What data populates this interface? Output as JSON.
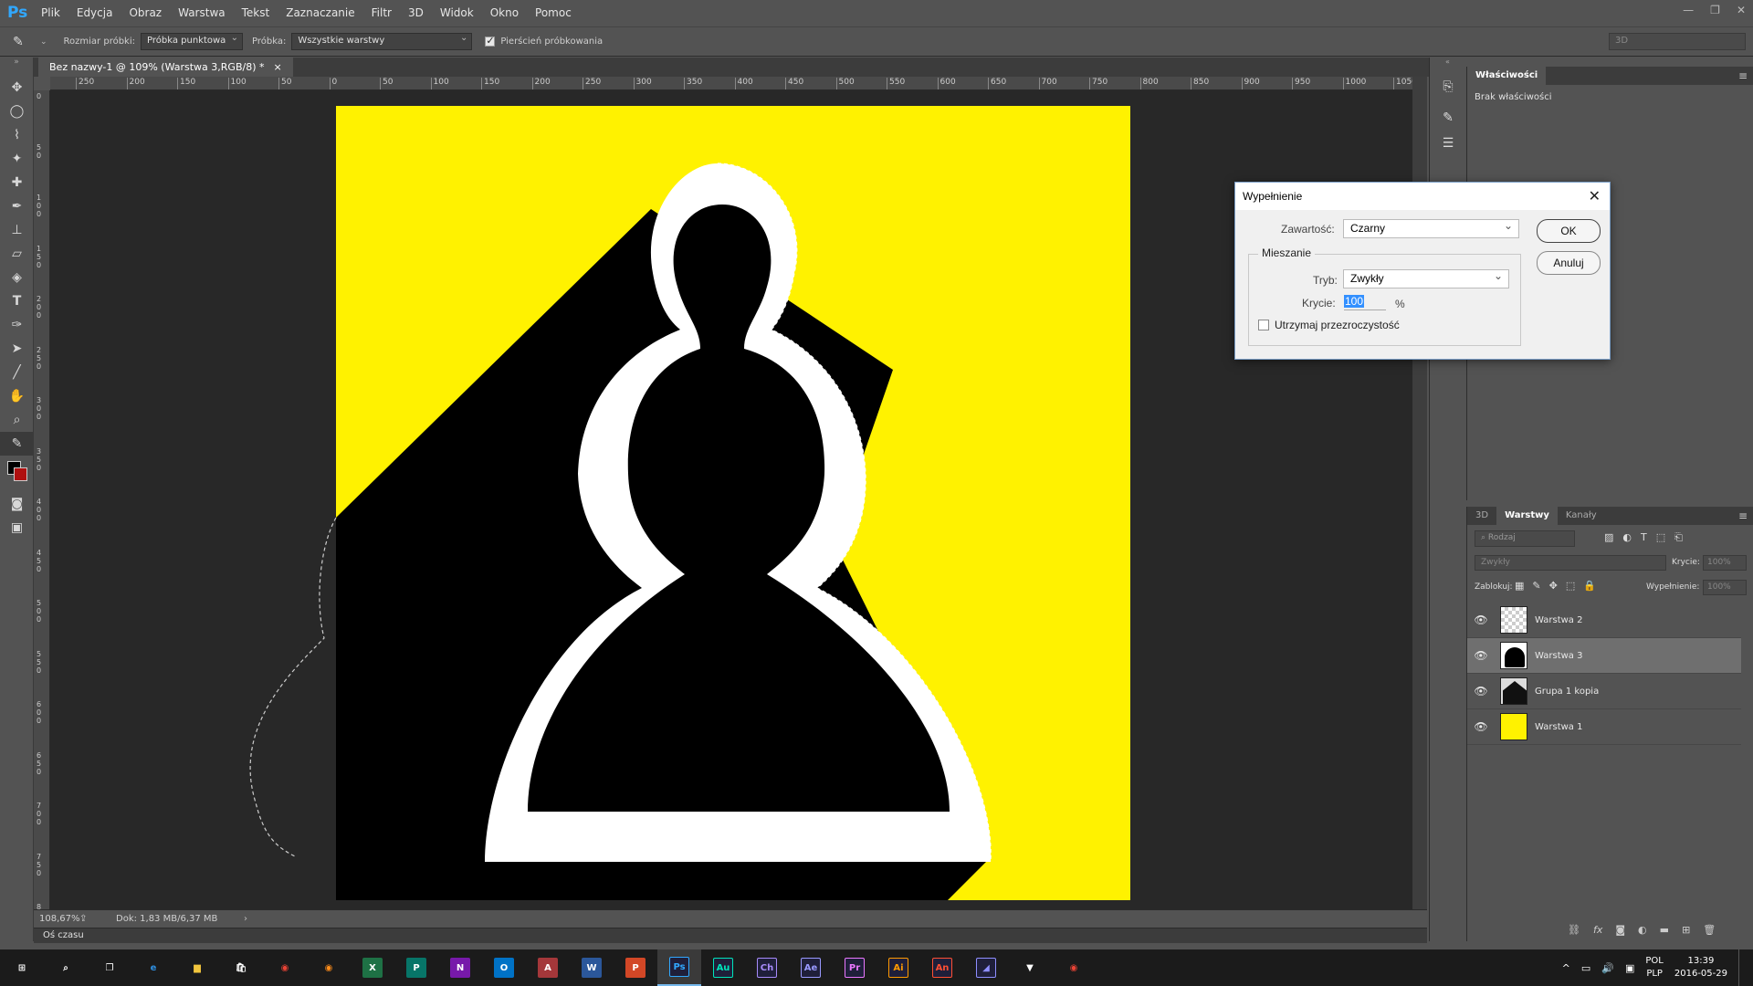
{
  "app": {
    "logo": "Ps",
    "menu": [
      "Plik",
      "Edycja",
      "Obraz",
      "Warstwa",
      "Tekst",
      "Zaznaczanie",
      "Filtr",
      "3D",
      "Widok",
      "Okno",
      "Pomoc"
    ],
    "window_controls": [
      "—",
      "❐",
      "✕"
    ]
  },
  "options_bar": {
    "sample_size_label": "Rozmiar próbki:",
    "sample_size_value": "Próbka punktowa",
    "sample_label": "Próbka:",
    "sample_value": "Wszystkie warstwy",
    "sampling_ring_label": "Pierścień próbkowania",
    "sampling_ring_checked": true,
    "workspace_value": "3D"
  },
  "document": {
    "tab_title": "Bez nazwy-1 @ 109% (Warstwa 3,RGB/8) *",
    "tab_close": "×",
    "zoom": "108,67%",
    "doc_size": "Dok: 1,83 MB/6,37 MB",
    "ruler_top": [
      "250",
      "200",
      "150",
      "100",
      "50",
      "0",
      "50",
      "100",
      "150",
      "200",
      "250",
      "300",
      "350",
      "400",
      "450",
      "500",
      "550",
      "600",
      "650",
      "700",
      "750",
      "800",
      "850",
      "900",
      "950",
      "1000",
      "1050"
    ],
    "ruler_left": [
      "0",
      "5 0",
      "1 0 0",
      "1 5 0",
      "2 0 0",
      "2 5 0",
      "3 0 0",
      "3 5 0",
      "4 0 0",
      "4 5 0",
      "5 0 0",
      "5 5 0",
      "6 0 0",
      "6 5 0",
      "7 0 0",
      "7 5 0",
      "8"
    ],
    "canvas_colors": {
      "yellow": "#fff200",
      "black": "#000000",
      "white": "#ffffff"
    }
  },
  "timeline_label": "Oś czasu",
  "properties_panel": {
    "tab": "Właściwości",
    "empty_text": "Brak właściwości"
  },
  "layers_panel": {
    "tabs": [
      "3D",
      "Warstwy",
      "Kanały"
    ],
    "active_tab": "Warstwy",
    "filter_placeholder": "Rodzaj",
    "blend_mode": "Zwykły",
    "opacity_label": "Krycie:",
    "opacity_value": "100%",
    "lock_label": "Zablokuj:",
    "fill_label": "Wypełnienie:",
    "fill_value": "100%",
    "layers": [
      {
        "name": "Warstwa 2",
        "thumb": "transparent",
        "visible": true,
        "selected": false
      },
      {
        "name": "Warstwa 3",
        "thumb": "pawn",
        "visible": true,
        "selected": true
      },
      {
        "name": "Grupa 1 kopia",
        "thumb": "pawn-dark",
        "visible": true,
        "selected": false
      },
      {
        "name": "Warstwa 1",
        "thumb": "yellow",
        "visible": true,
        "selected": false
      }
    ],
    "footer_icons": [
      "link-icon",
      "fx-icon",
      "mask-icon",
      "adjustment-icon",
      "folder-icon",
      "new-layer-icon",
      "trash-icon"
    ]
  },
  "fill_dialog": {
    "title": "Wypełnienie",
    "content_label": "Zawartość:",
    "content_value": "Czarny",
    "blending_group": "Mieszanie",
    "mode_label": "Tryb:",
    "mode_value": "Zwykły",
    "opacity_label": "Krycie:",
    "opacity_value": "100",
    "opacity_unit": "%",
    "preserve_label": "Utrzymaj przezroczystość",
    "preserve_checked": false,
    "ok_label": "OK",
    "cancel_label": "Anuluj"
  },
  "taskbar": {
    "apps": [
      {
        "name": "start",
        "label": "⊞",
        "color": "#ffffff"
      },
      {
        "name": "search",
        "label": "⌕",
        "color": "#ffffff"
      },
      {
        "name": "task-view",
        "label": "❐",
        "color": "#ffffff"
      },
      {
        "name": "edge",
        "label": "e",
        "color": "#2f8fe0"
      },
      {
        "name": "explorer",
        "label": "▆",
        "color": "#f2c53d"
      },
      {
        "name": "store",
        "label": "🛍",
        "color": "#ffffff"
      },
      {
        "name": "chrome",
        "label": "◉",
        "color": "#ea4335"
      },
      {
        "name": "firefox",
        "label": "◉",
        "color": "#ff8c1a"
      },
      {
        "name": "excel",
        "label": "X",
        "color": "#1e7145"
      },
      {
        "name": "publisher",
        "label": "P",
        "color": "#077568"
      },
      {
        "name": "onenote",
        "label": "N",
        "color": "#7719aa"
      },
      {
        "name": "outlook",
        "label": "O",
        "color": "#0072c6"
      },
      {
        "name": "access",
        "label": "A",
        "color": "#a4373a"
      },
      {
        "name": "word",
        "label": "W",
        "color": "#2b579a"
      },
      {
        "name": "powerpoint",
        "label": "P",
        "color": "#d24726"
      },
      {
        "name": "photoshop",
        "label": "Ps",
        "color": "#31a8ff"
      },
      {
        "name": "audition",
        "label": "Au",
        "color": "#00e4bb"
      },
      {
        "name": "character-animator",
        "label": "Ch",
        "color": "#a78bfa"
      },
      {
        "name": "after-effects",
        "label": "Ae",
        "color": "#9999ff"
      },
      {
        "name": "premiere",
        "label": "Pr",
        "color": "#ea77ff"
      },
      {
        "name": "illustrator",
        "label": "Ai",
        "color": "#ff9a00"
      },
      {
        "name": "animate",
        "label": "An",
        "color": "#ff4f33"
      },
      {
        "name": "media-encoder",
        "label": "◢",
        "color": "#8f8fff"
      },
      {
        "name": "fox-app",
        "label": "▼",
        "color": "#ffffff"
      },
      {
        "name": "chrome-2",
        "label": "◉",
        "color": "#ea4335"
      }
    ],
    "tray_icons": [
      "^",
      "▭",
      "🔊",
      "▣"
    ],
    "lang_top": "POL",
    "lang_bottom": "PLP",
    "time": "13:39",
    "date": "2016-05-29"
  }
}
